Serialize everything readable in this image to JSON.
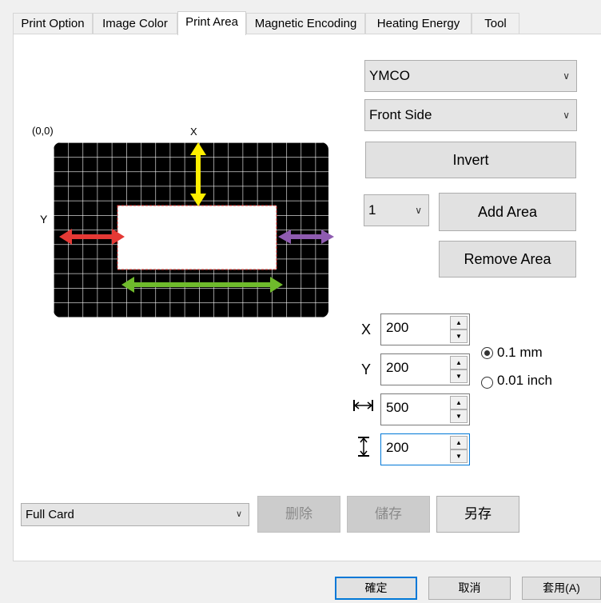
{
  "tabs": [
    "Print Option",
    "Image Color",
    "Print Area",
    "Magnetic Encoding",
    "Heating Energy",
    "Tool"
  ],
  "active_tab": "Print Area",
  "panel": {
    "color_select": "YMCO",
    "side_select": "Front Side",
    "invert_label": "Invert",
    "area_index": "1",
    "add_area_label": "Add Area",
    "remove_area_label": "Remove Area"
  },
  "diagram": {
    "origin_label": "(0,0)",
    "x_label": "X",
    "y_label": "Y",
    "colors": {
      "x_arrow": "#ffef00",
      "y_arrow": "#e53935",
      "width_arrow": "#6fba2c",
      "right_arrow": "#8e5bb0"
    }
  },
  "fields": {
    "x_label": "X",
    "x_value": "200",
    "y_label": "Y",
    "y_value": "200",
    "width_icon": "width-icon",
    "width_value": "500",
    "height_icon": "height-icon",
    "height_value": "200"
  },
  "units": {
    "mm_label": "0.1 mm",
    "inch_label": "0.01 inch",
    "selected": "0.1 mm"
  },
  "preset": {
    "select_value": "Full Card",
    "delete_label": "删除",
    "save_label": "儲存",
    "save_as_label": "另存"
  },
  "footer": {
    "ok_label": "確定",
    "cancel_label": "取消",
    "apply_label": "套用(A)"
  }
}
